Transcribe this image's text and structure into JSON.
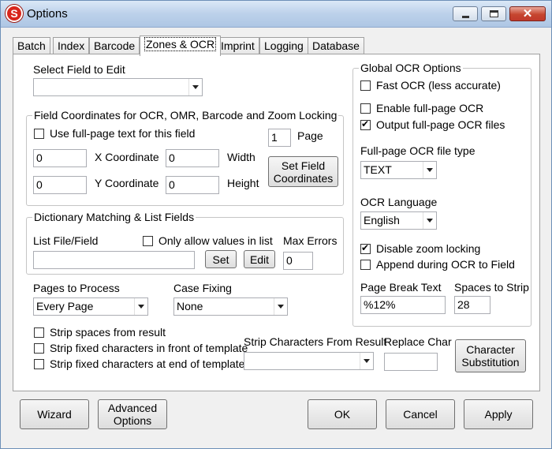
{
  "window": {
    "title": "Options",
    "close_glyph": "✕"
  },
  "tabs": [
    {
      "label": "Batch"
    },
    {
      "label": "Index"
    },
    {
      "label": "Barcode"
    },
    {
      "label": "Zones & OCR",
      "active": true
    },
    {
      "label": "Imprint"
    },
    {
      "label": "Logging"
    },
    {
      "label": "Database"
    }
  ],
  "select_field": {
    "label": "Select Field to Edit",
    "value": ""
  },
  "field_coords": {
    "title": "Field Coordinates for OCR, OMR, Barcode and Zoom Locking",
    "use_full_page_label": "Use full-page text for this field",
    "use_full_page_checked": false,
    "page_value": "1",
    "page_label": "Page",
    "x_value": "0",
    "x_label": "X Coordinate",
    "width_value": "0",
    "width_label": "Width",
    "y_value": "0",
    "y_label": "Y Coordinate",
    "height_value": "0",
    "height_label": "Height",
    "set_coords_line1": "Set Field",
    "set_coords_line2": "Coordinates"
  },
  "dictionary": {
    "title": "Dictionary Matching & List Fields",
    "list_label": "List File/Field",
    "list_value": "",
    "only_allow_label": "Only allow values in list",
    "only_allow_checked": false,
    "max_errors_label": "Max Errors",
    "max_errors_value": "0",
    "set_label": "Set",
    "edit_label": "Edit"
  },
  "pages_to_process": {
    "label": "Pages to Process",
    "value": "Every Page"
  },
  "case_fixing": {
    "label": "Case Fixing",
    "value": "None"
  },
  "strip_options": [
    {
      "label": "Strip spaces from result",
      "checked": false
    },
    {
      "label": "Strip fixed characters in front of template",
      "checked": false
    },
    {
      "label": "Strip fixed characters at end of template",
      "checked": false
    }
  ],
  "strip_chars": {
    "label": "Strip Characters From Result",
    "value": ""
  },
  "replace_char": {
    "label": "Replace Char",
    "value": ""
  },
  "char_sub": {
    "line1": "Character",
    "line2": "Substitution"
  },
  "global_ocr": {
    "title": "Global OCR Options",
    "fast_ocr": {
      "label": "Fast OCR (less accurate)",
      "checked": false
    },
    "enable_full_page": {
      "label": "Enable full-page OCR",
      "checked": false
    },
    "output_full_page": {
      "label": "Output full-page OCR files",
      "checked": true
    },
    "file_type_label": "Full-page OCR file type",
    "file_type_value": "TEXT",
    "language_label": "OCR Language",
    "language_value": "English",
    "disable_zoom": {
      "label": "Disable zoom locking",
      "checked": true
    },
    "append_during": {
      "label": "Append during OCR to Field",
      "checked": false
    },
    "page_break_label": "Page Break Text",
    "page_break_value": "%12%",
    "spaces_label": "Spaces to Strip",
    "spaces_value": "28"
  },
  "footer": {
    "wizard": "Wizard",
    "advanced_line1": "Advanced",
    "advanced_line2": "Options",
    "ok": "OK",
    "cancel": "Cancel",
    "apply": "Apply"
  }
}
